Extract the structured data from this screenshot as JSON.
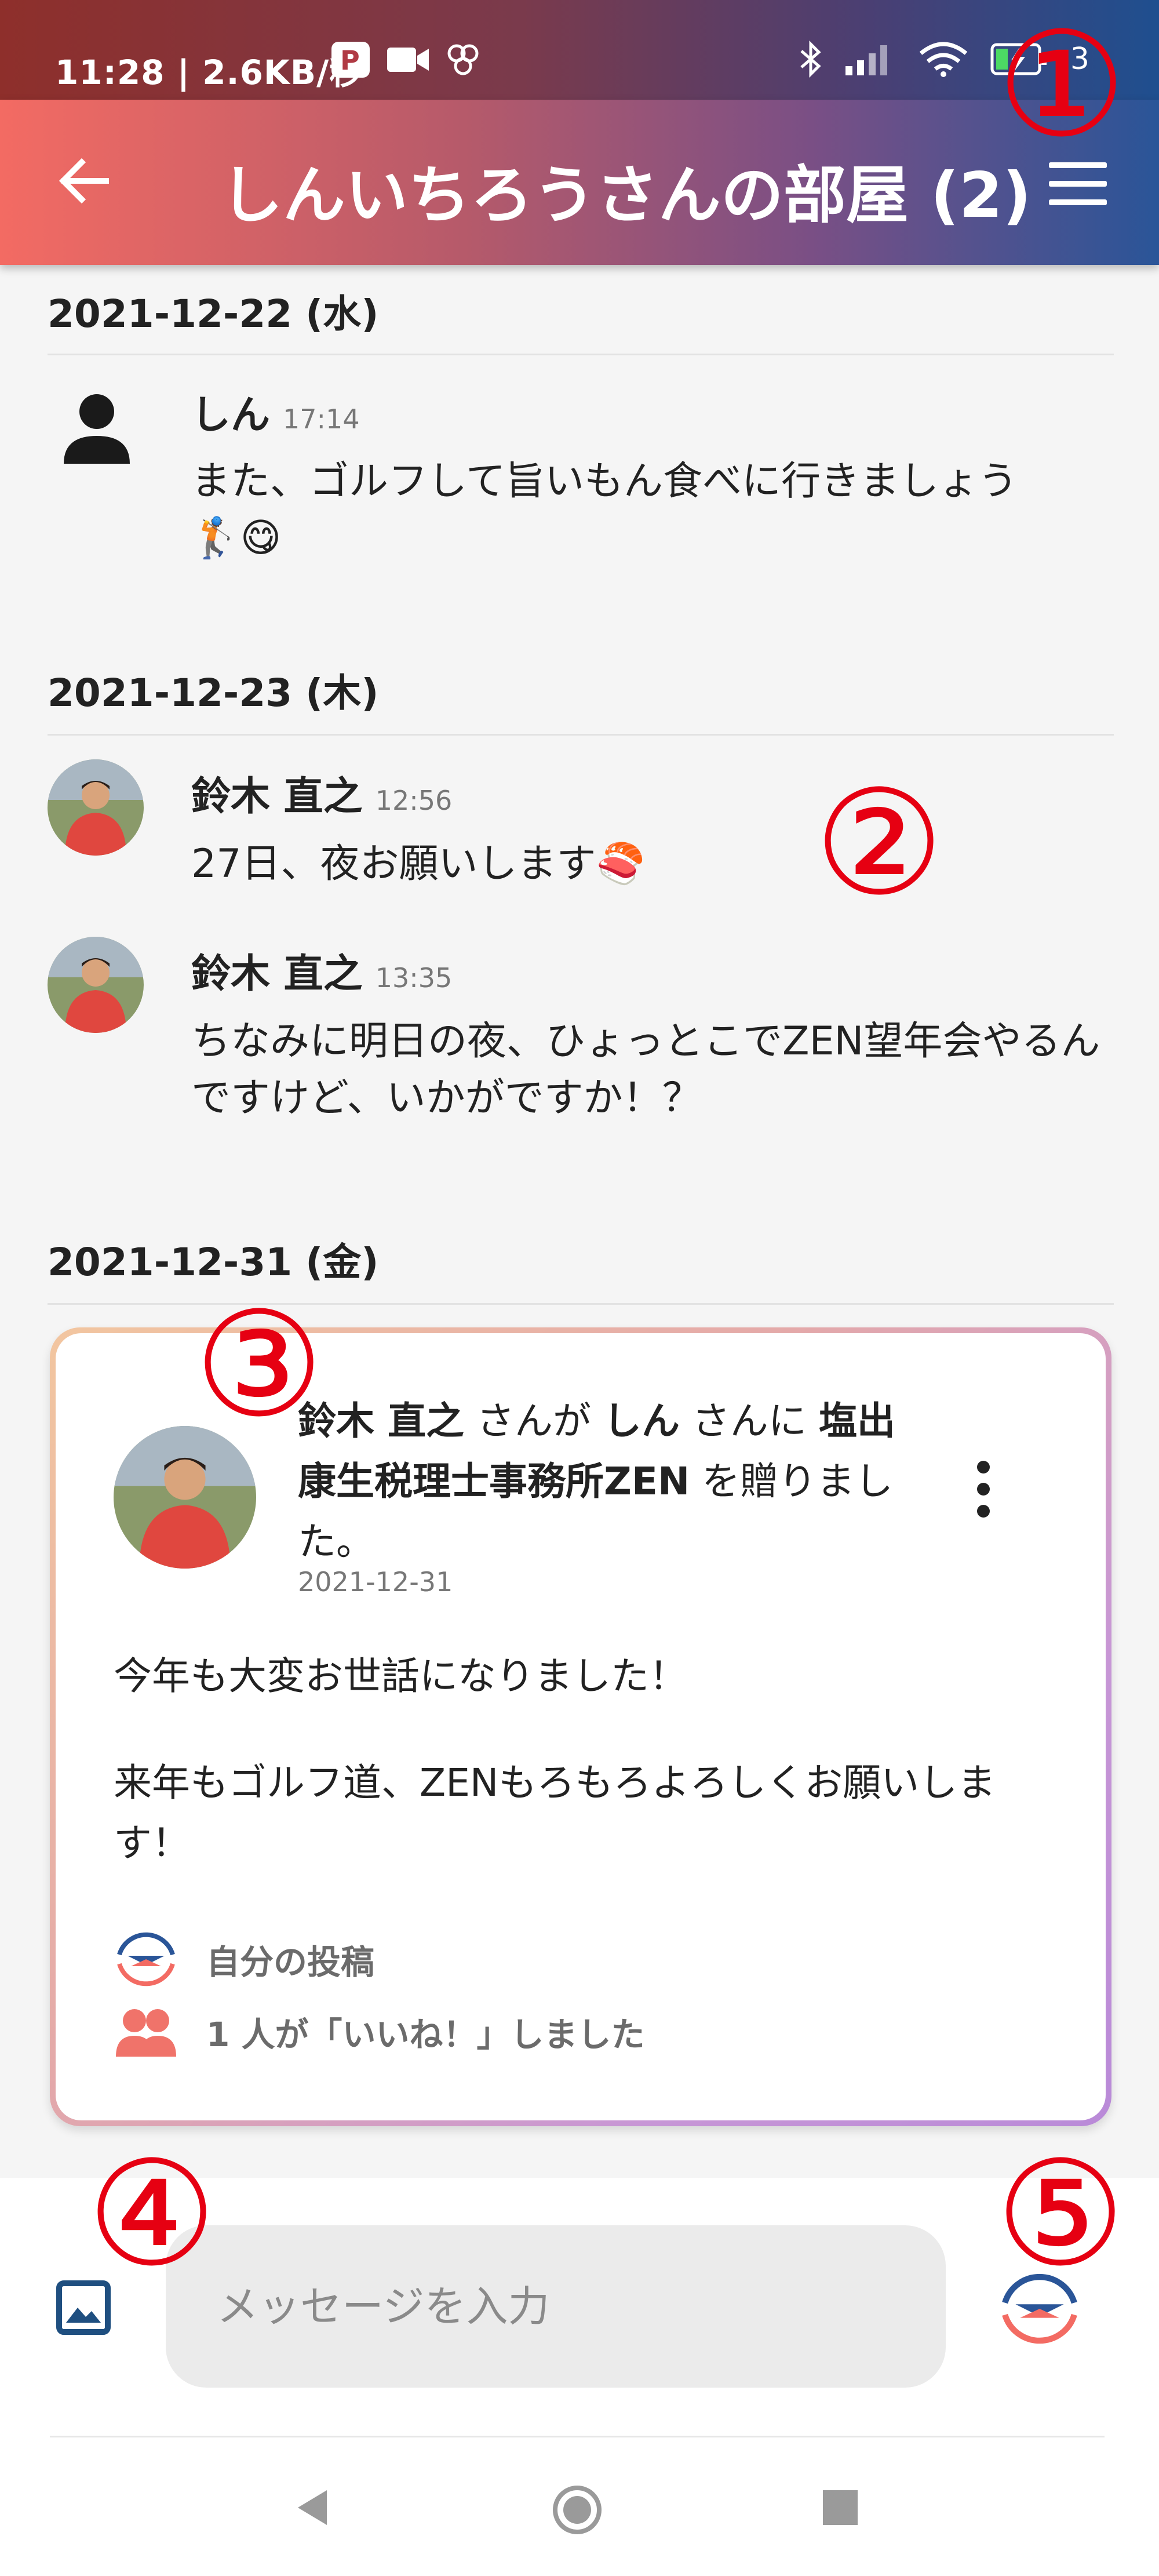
{
  "status_bar": {
    "time": "11:28 | 2.6KB/秒",
    "battery": "3",
    "icons": [
      "paypay-icon",
      "video-icon",
      "pinwheel-icon",
      "bluetooth-icon",
      "signal-icon",
      "wifi-icon",
      "battery-charging-icon"
    ]
  },
  "app_bar": {
    "title": "しんいちろうさんの部屋 (2)",
    "back_icon": "arrow-left-icon",
    "menu_icon": "hamburger-menu-icon"
  },
  "messages": [
    {
      "date": "2021-12-22 (水)",
      "items": [
        {
          "sender": "しん",
          "time": "17:14",
          "text": "また、ゴルフして旨いもん食べに行きましょう",
          "emoji": "🏌😋",
          "avatar": "person-silhouette"
        }
      ]
    },
    {
      "date": "2021-12-23 (木)",
      "items": [
        {
          "sender": "鈴木 直之",
          "time": "12:56",
          "text": "27日、夜お願いします🍣",
          "avatar": "photo"
        },
        {
          "sender": "鈴木 直之",
          "time": "13:35",
          "text": "ちなみに明日の夜、ひょっとこでZEN望年会やるんですけど、いかがですか！？",
          "avatar": "photo"
        }
      ]
    },
    {
      "date": "2021-12-31 (金)",
      "items": []
    }
  ],
  "gift_card": {
    "sender": "鈴木 直之",
    "text_1": " さんが ",
    "recipient": "しん",
    "text_2": " さんに ",
    "gift": "塩出康生税理士事務所ZEN",
    "text_3": " を贈りました。",
    "date": "2021-12-31",
    "body_line1": "今年も大変お世話になりました！",
    "body_line2": "来年もゴルフ道、ZENもろもろよろしくお願いします！",
    "own_post_label": "自分の投稿",
    "likes_label": "1 人が「いいね！」しました"
  },
  "composer": {
    "placeholder": "メッセージを入力"
  },
  "annotations": [
    "①",
    "②",
    "③",
    "④",
    "⑤"
  ],
  "colors": {
    "accent_red": "#e60012",
    "brand_coral": "#f36b63",
    "brand_blue": "#2a5598"
  }
}
